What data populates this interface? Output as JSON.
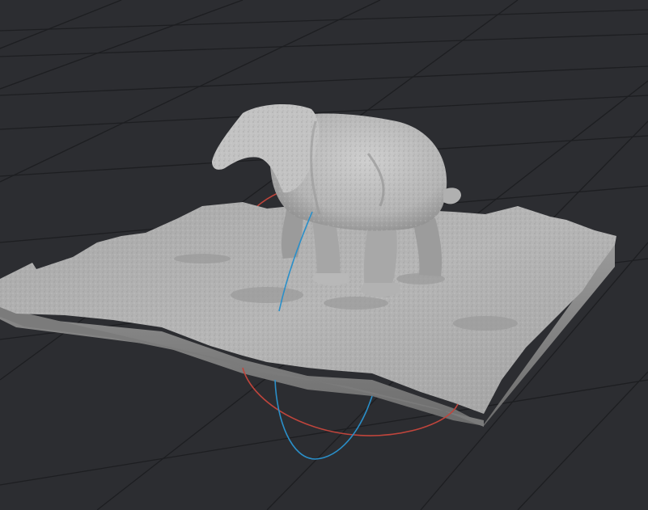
{
  "viewport": {
    "background_color": "#2c2d31",
    "grid_color": "#1d1e21",
    "model_color": "#b9b9b9",
    "model_shadow_color": "#8a8a8a",
    "gizmo_x_color": "#c0453c",
    "gizmo_z_color": "#2a8fc9",
    "gizmo_icon": "rotate-gizmo-icon",
    "model": "photogrammetry-scan-mesh"
  }
}
